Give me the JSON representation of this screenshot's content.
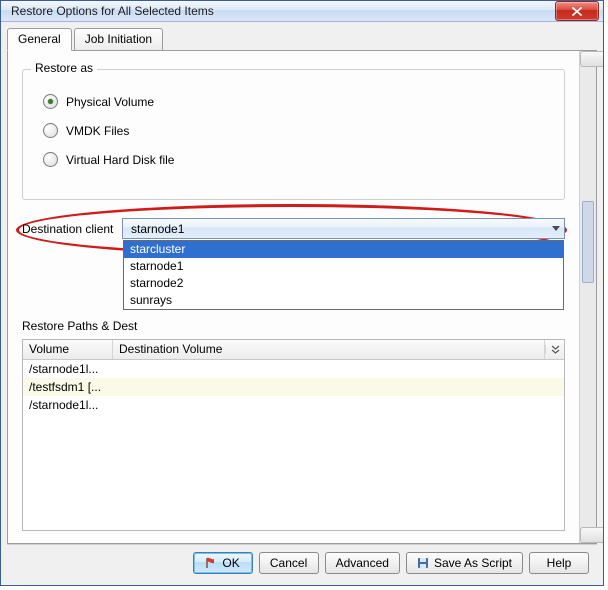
{
  "window": {
    "title": "Restore Options for All Selected Items"
  },
  "tabs": {
    "general": "General",
    "job_initiation": "Job Initiation"
  },
  "restore_as": {
    "legend": "Restore as",
    "physical_volume": "Physical Volume",
    "vmdk_files": "VMDK Files",
    "vhd_file": "Virtual Hard Disk file"
  },
  "destination": {
    "label": "Destination client",
    "selected": "starnode1",
    "options": [
      "starcluster",
      "starnode1",
      "starnode2",
      "sunrays"
    ]
  },
  "paths_section": {
    "label": "Restore Paths & Dest"
  },
  "grid": {
    "col_volume": "Volume",
    "col_dest": "Destination Volume",
    "rows": [
      {
        "volume": "/starnode1l...",
        "dest": ""
      },
      {
        "volume": "/testfsdm1 [...",
        "dest": ""
      },
      {
        "volume": "/starnode1l...",
        "dest": ""
      }
    ]
  },
  "buttons": {
    "ok": "OK",
    "cancel": "Cancel",
    "advanced": "Advanced",
    "save_script": "Save As Script",
    "help": "Help"
  }
}
